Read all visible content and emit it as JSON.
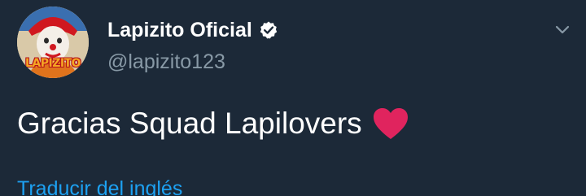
{
  "tweet": {
    "author": {
      "display_name": "Lapizito Oficial",
      "handle": "@lapizito123",
      "verified": true,
      "avatar_logo_text": "LAPIZITO"
    },
    "text": "Gracias Squad Lapilovers",
    "emoji": "heart-icon",
    "translate_label": "Traducir del inglés",
    "menu_icon": "chevron-down-icon"
  },
  "colors": {
    "background": "#1c2938",
    "name": "#ffffff",
    "handle": "#8899a6",
    "link": "#1da1f2",
    "heart": "#e0245e"
  }
}
